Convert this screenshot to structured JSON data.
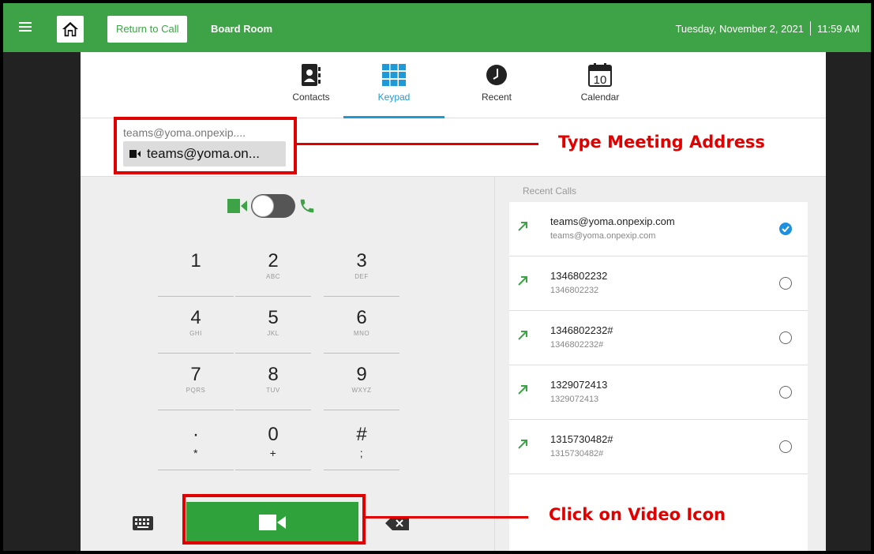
{
  "topbar": {
    "home_icon": "home-icon",
    "return_label": "Return to Call",
    "room_name": "Board Room",
    "date": "Tuesday, November 2, 2021",
    "time": "11:59 AM",
    "accent": "#3ea346"
  },
  "tabs": [
    {
      "label": "Contacts",
      "icon": "contacts-icon"
    },
    {
      "label": "Keypad",
      "icon": "keypad-icon",
      "active": true
    },
    {
      "label": "Recent",
      "icon": "clock-icon"
    },
    {
      "label": "Calendar",
      "icon": "calendar-icon",
      "day": "10"
    }
  ],
  "address": {
    "text": "teams@yoma.onpexip....",
    "chip": "teams@yoma.on..."
  },
  "keypad": {
    "keys": [
      {
        "digit": "1",
        "sub": ""
      },
      {
        "digit": "2",
        "sub": "ABC"
      },
      {
        "digit": "3",
        "sub": "DEF"
      },
      {
        "digit": "4",
        "sub": "GHI"
      },
      {
        "digit": "5",
        "sub": "JKL"
      },
      {
        "digit": "6",
        "sub": "MNO"
      },
      {
        "digit": "7",
        "sub": "PQRS"
      },
      {
        "digit": "8",
        "sub": "TUV"
      },
      {
        "digit": "9",
        "sub": "WXYZ"
      },
      {
        "digit": "·",
        "sub": "*"
      },
      {
        "digit": "0",
        "sub": "+"
      },
      {
        "digit": "#",
        "sub": ";"
      }
    ]
  },
  "recent": {
    "title": "Recent Calls",
    "items": [
      {
        "name": "teams@yoma.onpexip.com",
        "address": "teams@yoma.onpexip.com",
        "selected": true
      },
      {
        "name": "1346802232",
        "address": "1346802232",
        "selected": false
      },
      {
        "name": "1346802232#",
        "address": "1346802232#",
        "selected": false
      },
      {
        "name": "1329072413",
        "address": "1329072413",
        "selected": false
      },
      {
        "name": "1315730482#",
        "address": "1315730482#",
        "selected": false
      }
    ]
  },
  "annotations": {
    "address_label": "Type Meeting Address",
    "call_label": "Click on Video Icon",
    "color": "#e00000"
  }
}
